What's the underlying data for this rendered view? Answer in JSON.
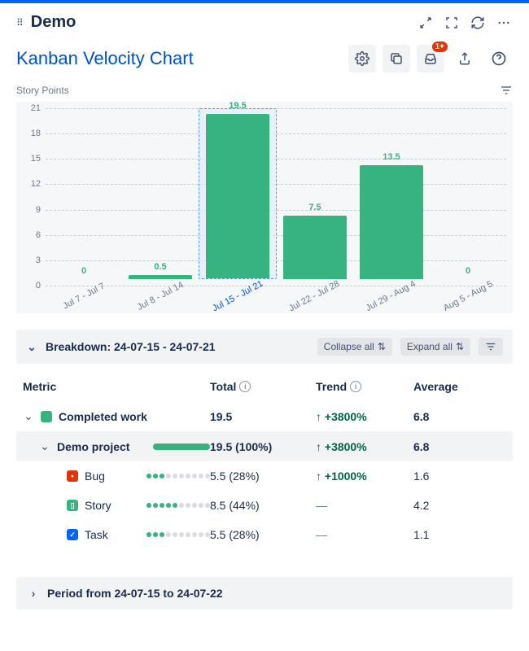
{
  "header": {
    "title": "Demo"
  },
  "page_title": "Kanban Velocity Chart",
  "notif_badge": "1+",
  "chart_data": {
    "type": "bar",
    "ylabel": "Story Points",
    "ylim": [
      0,
      21
    ],
    "yticks": [
      0,
      3,
      6,
      9,
      12,
      15,
      18,
      21
    ],
    "categories": [
      "Jul 7 - Jul 7",
      "Jul 8 - Jul 14",
      "Jul 15 - Jul 21",
      "Jul 22 - Jul 28",
      "Jul 29 - Aug 4",
      "Aug 5 - Aug 5"
    ],
    "values": [
      0,
      0.5,
      19.5,
      7.5,
      13.5,
      0
    ],
    "selected_index": 2
  },
  "breakdown": {
    "title_prefix": "Breakdown: ",
    "range": "24-07-15 - 24-07-21",
    "collapse_label": "Collapse all",
    "expand_label": "Expand all"
  },
  "table": {
    "headers": {
      "metric": "Metric",
      "total": "Total",
      "trend": "Trend",
      "avg": "Average"
    },
    "rows": [
      {
        "kind": "group",
        "label": "Completed work",
        "total": "19.5",
        "trend": "+3800%",
        "trend_dir": "up",
        "avg": "6.8"
      },
      {
        "kind": "project",
        "label": "Demo project",
        "total": "19.5 (100%)",
        "trend": "+3800%",
        "trend_dir": "up",
        "avg": "6.8"
      },
      {
        "kind": "item",
        "icon": "red",
        "label": "Bug",
        "dots_on": 3,
        "dots_total": 10,
        "total": "5.5 (28%)",
        "trend": "+1000%",
        "trend_dir": "up",
        "avg": "1.6"
      },
      {
        "kind": "item",
        "icon": "gbook",
        "label": "Story",
        "dots_on": 5,
        "dots_total": 10,
        "total": "8.5 (44%)",
        "trend": "—",
        "trend_dir": "none",
        "avg": "4.2"
      },
      {
        "kind": "item",
        "icon": "blue",
        "label": "Task",
        "dots_on": 3,
        "dots_total": 10,
        "total": "5.5 (28%)",
        "trend": "—",
        "trend_dir": "none",
        "avg": "1.1"
      }
    ]
  },
  "period": {
    "prefix": "Period from ",
    "range": "24-07-15 to 24-07-22"
  }
}
